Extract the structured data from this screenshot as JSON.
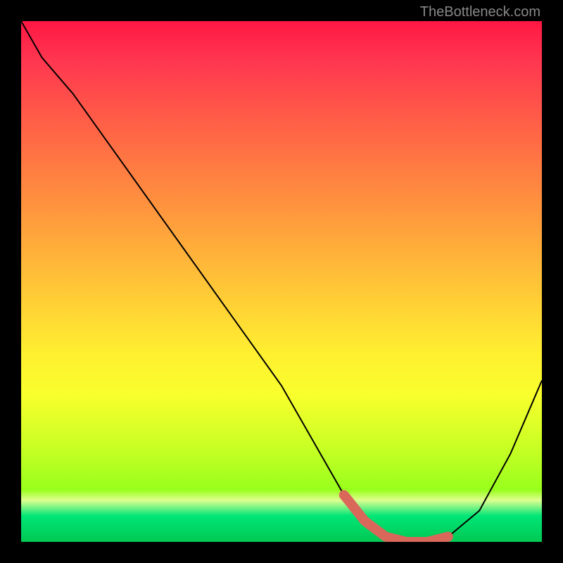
{
  "watermark": "TheBottleneck.com",
  "chart_data": {
    "type": "line",
    "title": "",
    "xlabel": "",
    "ylabel": "",
    "xlim": [
      0,
      100
    ],
    "ylim": [
      0,
      100
    ],
    "series": [
      {
        "name": "curve",
        "color": "#000000",
        "x": [
          0,
          4,
          10,
          20,
          30,
          40,
          50,
          58,
          62,
          66,
          70,
          74,
          78,
          82,
          88,
          94,
          100
        ],
        "y": [
          100,
          93,
          86,
          72,
          58,
          44,
          30,
          16,
          9,
          4,
          1,
          0,
          0,
          1,
          6,
          17,
          31
        ]
      },
      {
        "name": "highlight-band",
        "color": "#d9685a",
        "x": [
          62,
          66,
          70,
          74,
          78,
          82
        ],
        "y": [
          9,
          4,
          1,
          0,
          0,
          1
        ]
      }
    ]
  }
}
